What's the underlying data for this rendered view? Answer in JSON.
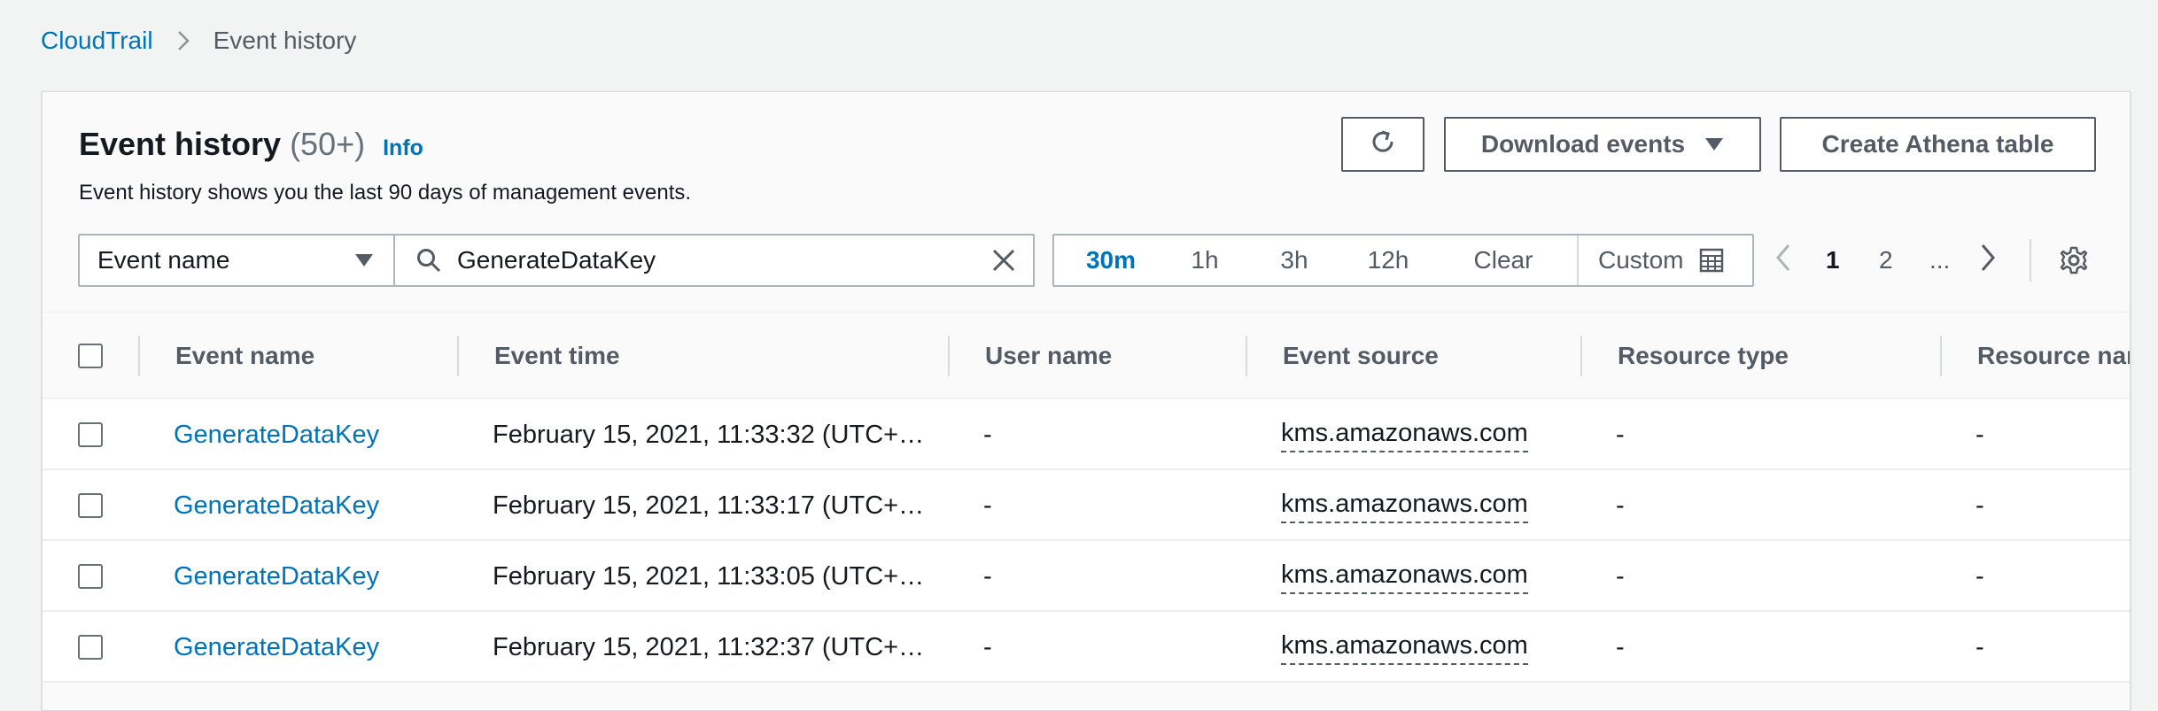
{
  "breadcrumb": {
    "root": "CloudTrail",
    "current": "Event history"
  },
  "header": {
    "title": "Event history",
    "count": "(50+)",
    "info": "Info",
    "description": "Event history shows you the last 90 days of management events."
  },
  "actions": {
    "refresh_icon": "refresh-icon",
    "download_label": "Download events",
    "athena_label": "Create Athena table"
  },
  "filter": {
    "attribute": "Event name",
    "value": "GenerateDataKey"
  },
  "time_range": {
    "options": [
      "30m",
      "1h",
      "3h",
      "12h"
    ],
    "selected": "30m",
    "clear": "Clear",
    "custom": "Custom"
  },
  "pagination": {
    "pages": [
      "1",
      "2"
    ],
    "current": "1",
    "ellipsis": "..."
  },
  "table": {
    "columns": [
      "Event name",
      "Event time",
      "User name",
      "Event source",
      "Resource type",
      "Resource nam"
    ],
    "rows": [
      {
        "event_name": "GenerateDataKey",
        "event_time": "February 15, 2021, 11:33:32 (UTC+…",
        "user_name": "-",
        "event_source": "kms.amazonaws.com",
        "resource_type": "-",
        "resource_name": "-"
      },
      {
        "event_name": "GenerateDataKey",
        "event_time": "February 15, 2021, 11:33:17 (UTC+…",
        "user_name": "-",
        "event_source": "kms.amazonaws.com",
        "resource_type": "-",
        "resource_name": "-"
      },
      {
        "event_name": "GenerateDataKey",
        "event_time": "February 15, 2021, 11:33:05 (UTC+…",
        "user_name": "-",
        "event_source": "kms.amazonaws.com",
        "resource_type": "-",
        "resource_name": "-"
      },
      {
        "event_name": "GenerateDataKey",
        "event_time": "February 15, 2021, 11:32:37 (UTC+…",
        "user_name": "-",
        "event_source": "kms.amazonaws.com",
        "resource_type": "-",
        "resource_name": "-"
      }
    ]
  },
  "colors": {
    "link": "#0073bb",
    "text": "#16191f",
    "muted": "#545b64",
    "border": "#aab7b8"
  }
}
